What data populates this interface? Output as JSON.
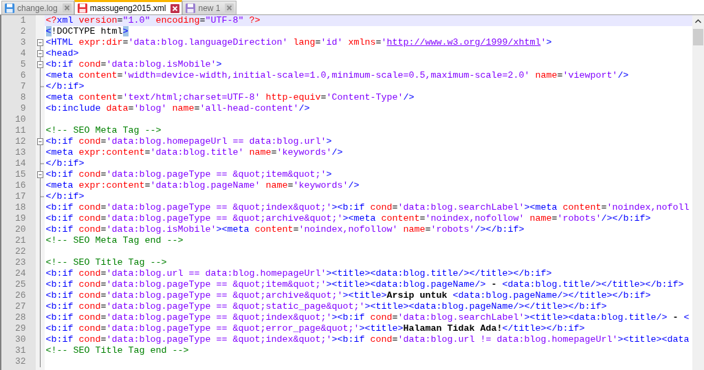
{
  "tabs": [
    {
      "label": "change.log",
      "selected": false,
      "color": "#3c8ee0"
    },
    {
      "label": "massugeng2015.xml",
      "selected": true,
      "color": "#e8343c"
    },
    {
      "label": "new 1",
      "selected": false,
      "color": "#9a7fd0"
    }
  ],
  "lines": [
    {
      "number": "1",
      "kind": "plain",
      "current": true,
      "brace_match": false,
      "text": "<?xml version=\"1.0\" encoding=\"UTF-8\" ?>"
    },
    {
      "number": "2",
      "kind": "plain",
      "current": false,
      "brace_match": true,
      "text": "<!DOCTYPE html>"
    },
    {
      "number": "3",
      "kind": "fold_start",
      "current": false,
      "brace_match": false,
      "text": "<HTML expr:dir='data:blog.languageDirection' lang='id' xmlns='http://www.w3.org/1999/xhtml'>"
    },
    {
      "number": "4",
      "kind": "fold_start",
      "current": false,
      "brace_match": false,
      "text": "<head>"
    },
    {
      "number": "5",
      "kind": "fold_start",
      "current": false,
      "brace_match": false,
      "text": "<b:if cond='data:blog.isMobile'>"
    },
    {
      "number": "6",
      "kind": "plain",
      "current": false,
      "brace_match": false,
      "text": "<meta content='width=device-width,initial-scale=1.0,minimum-scale=0.5,maximum-scale=2.0' name='viewport'/>"
    },
    {
      "number": "7",
      "kind": "fold_end",
      "current": false,
      "brace_match": false,
      "text": "</b:if>"
    },
    {
      "number": "8",
      "kind": "plain",
      "current": false,
      "brace_match": false,
      "text": "<meta content='text/html;charset=UTF-8' http-equiv='Content-Type'/>"
    },
    {
      "number": "9",
      "kind": "plain",
      "current": false,
      "brace_match": false,
      "text": "<b:include data='blog' name='all-head-content'/>"
    },
    {
      "number": "10",
      "kind": "plain",
      "current": false
    },
    {
      "number": "11",
      "kind": "plain",
      "current": false,
      "brace_match": false,
      "text": "<!-- SEO Meta Tag -->"
    },
    {
      "number": "12",
      "kind": "fold_start",
      "current": false,
      "brace_match": false,
      "text": "<b:if cond='data:blog.homepageUrl == data:blog.url'>"
    },
    {
      "number": "13",
      "kind": "plain",
      "current": false,
      "brace_match": false,
      "text": "<meta expr:content='data:blog.title' name='keywords'/>"
    },
    {
      "number": "14",
      "kind": "fold_end",
      "current": false,
      "brace_match": false,
      "text": "</b:if>"
    },
    {
      "number": "15",
      "kind": "fold_start",
      "current": false,
      "brace_match": false,
      "text": "<b:if cond='data:blog.pageType == &quot;item&quot;'>"
    },
    {
      "number": "16",
      "kind": "plain",
      "current": false,
      "brace_match": false,
      "text": "<meta expr:content='data:blog.pageName' name='keywords'/>"
    },
    {
      "number": "17",
      "kind": "fold_end",
      "current": false,
      "brace_match": false,
      "text": "</b:if>"
    },
    {
      "number": "18",
      "kind": "plain",
      "current": false,
      "brace_match": false,
      "text": "<b:if cond='data:blog.pageType == &quot;index&quot;'><b:if cond='data:blog.searchLabel'><meta content='noindex,nofoll"
    },
    {
      "number": "19",
      "kind": "plain",
      "current": false,
      "brace_match": false,
      "text": "<b:if cond='data:blog.pageType == &quot;archive&quot;'><meta content='noindex,nofollow' name='robots'/></b:if>"
    },
    {
      "number": "20",
      "kind": "plain",
      "current": false,
      "brace_match": false,
      "text": "<b:if cond='data:blog.isMobile'><meta content='noindex,nofollow' name='robots'/></b:if>"
    },
    {
      "number": "21",
      "kind": "plain",
      "current": false,
      "brace_match": false,
      "text": "<!-- SEO Meta Tag end -->"
    },
    {
      "number": "22",
      "kind": "plain",
      "current": false
    },
    {
      "number": "23",
      "kind": "plain",
      "current": false,
      "brace_match": false,
      "text": "<!-- SEO Title Tag -->"
    },
    {
      "number": "24",
      "kind": "plain",
      "current": false,
      "brace_match": false,
      "text": "<b:if cond='data:blog.url == data:blog.homepageUrl'><title><data:blog.title/></title></b:if>"
    },
    {
      "number": "25",
      "kind": "plain",
      "current": false,
      "brace_match": false,
      "text": "<b:if cond='data:blog.pageType == &quot;item&quot;'><title><data:blog.pageName/> - <data:blog.title/></title></b:if>"
    },
    {
      "number": "26",
      "kind": "plain",
      "current": false,
      "brace_match": false,
      "text": "<b:if cond='data:blog.pageType == &quot;archive&quot;'><title>Arsip untuk <data:blog.pageName/></title></b:if>"
    },
    {
      "number": "27",
      "kind": "plain",
      "current": false,
      "brace_match": false,
      "text": "<b:if cond='data:blog.pageType == &quot;static_page&quot;'><title><data:blog.pageName/></title></b:if>"
    },
    {
      "number": "28",
      "kind": "plain",
      "current": false,
      "brace_match": false,
      "text": "<b:if cond='data:blog.pageType == &quot;index&quot;'><b:if cond='data:blog.searchLabel'><title><data:blog.title/> - <"
    },
    {
      "number": "29",
      "kind": "plain",
      "current": false,
      "brace_match": false,
      "text": "<b:if cond='data:blog.pageType == &quot;error_page&quot;'><title>Halaman Tidak Ada!</title></b:if>"
    },
    {
      "number": "30",
      "kind": "plain",
      "current": false,
      "brace_match": false,
      "text": "<b:if cond='data:blog.pageType == &quot;index&quot;'><b:if cond='data:blog.url != data:blog.homepageUrl'><title><data"
    },
    {
      "number": "31",
      "kind": "plain",
      "current": false,
      "brace_match": false,
      "text": "<!-- SEO Title Tag end -->"
    },
    {
      "number": "32",
      "kind": "plain",
      "current": false
    }
  ]
}
